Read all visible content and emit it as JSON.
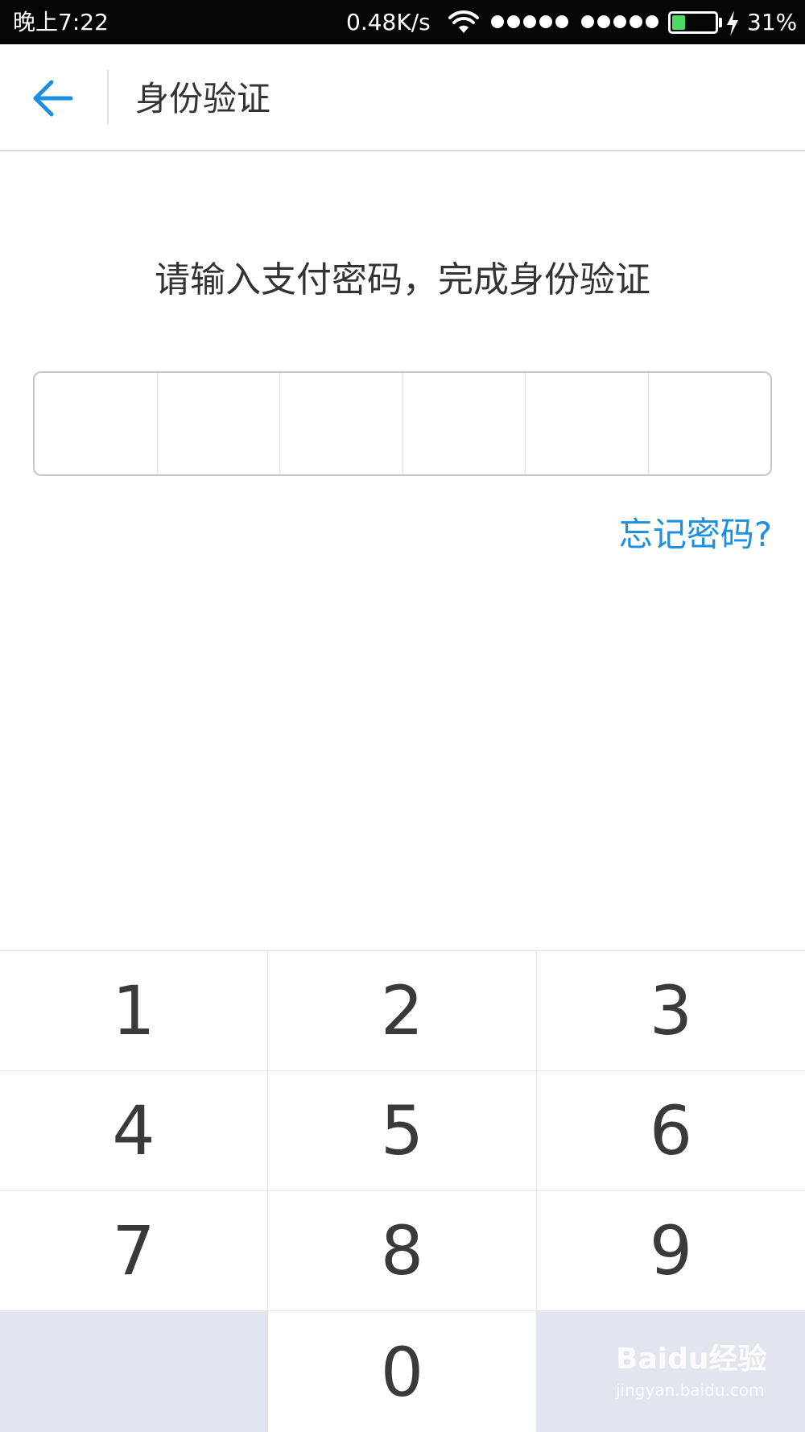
{
  "status_bar": {
    "time": "晚上7:22",
    "speed": "0.48K/s",
    "battery_percent": "31%",
    "battery_level": 0.31,
    "icons": [
      "wifi-icon",
      "signal-icon",
      "signal-icon",
      "battery-icon",
      "charging-icon"
    ]
  },
  "nav": {
    "back_icon": "back-arrow-icon",
    "title": "身份验证",
    "accent_color": "#1d8fe0"
  },
  "main": {
    "prompt": "请输入支付密码，完成身份验证",
    "password_digits": 6,
    "forgot_link": "忘记密码?"
  },
  "keypad": {
    "keys": [
      "1",
      "2",
      "3",
      "4",
      "5",
      "6",
      "7",
      "8",
      "9",
      "",
      "0",
      ""
    ]
  },
  "watermark": {
    "main": "Baidu经验",
    "sub": "jingyan.baidu.com"
  }
}
